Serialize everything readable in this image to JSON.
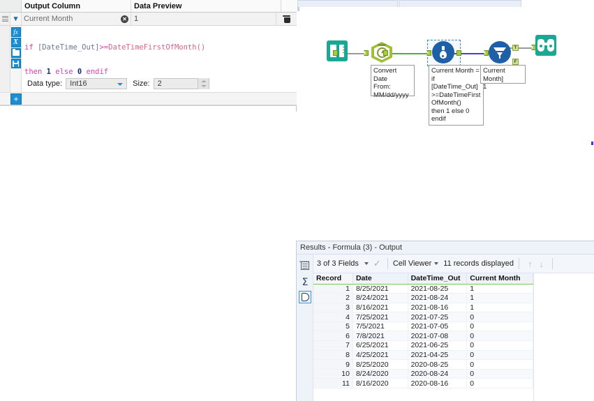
{
  "config_panel": {
    "headers": {
      "output_column": "Output Column",
      "data_preview": "Data Preview"
    },
    "row": {
      "output_column_value": "Current Month",
      "data_preview_value": "1",
      "clear_icon": "clear-circle-icon",
      "delete_icon": "trash-icon",
      "expand_icon": "chevron-down-icon",
      "drag_icon": "drag-handle-icon"
    },
    "rail_buttons": [
      {
        "name": "function-fx-button",
        "glyph": "fx"
      },
      {
        "name": "variable-x-button",
        "glyph": "X"
      },
      {
        "name": "open-folder-button",
        "glyph": "folder-icon"
      },
      {
        "name": "save-button",
        "glyph": "save-disk-icon"
      }
    ],
    "formula": {
      "line1": [
        {
          "t": "if ",
          "c": "kw"
        },
        {
          "t": "[DateTime_Out]",
          "c": "fld"
        },
        {
          "t": ">=",
          "c": "op"
        },
        {
          "t": "DateTimeFirstOfMonth()",
          "c": "fn"
        }
      ],
      "line2": [
        {
          "t": "then ",
          "c": "kw"
        },
        {
          "t": "1",
          "c": "num"
        },
        {
          "t": " else ",
          "c": "kw"
        },
        {
          "t": "0",
          "c": "num"
        },
        {
          "t": " endif",
          "c": "kw"
        }
      ],
      "plain_text": "if [DateTime_Out]>=DateTimeFirstOfMonth()\nthen 1 else 0 endif"
    },
    "data_type_label": "Data type:",
    "data_type_value": "Int16",
    "size_label": "Size:",
    "size_value": "2",
    "add_button_label": "+"
  },
  "canvas": {
    "nodes": [
      {
        "name": "input-data-tool",
        "icon": "book-input-icon",
        "label": ""
      },
      {
        "name": "datetime-tool",
        "icon": "clock-datetime-icon",
        "label": ""
      },
      {
        "name": "formula-tool",
        "icon": "flask-formula-icon",
        "label": "",
        "selected": true
      },
      {
        "name": "filter-tool",
        "icon": "funnel-filter-icon",
        "label": ""
      },
      {
        "name": "browse-tool",
        "icon": "binoculars-browse-icon",
        "label": ""
      }
    ],
    "annotations": {
      "datetime": "Convert Date\nFrom:\nMM/dd/yyyy",
      "formula": "Current Month =\nif [DateTime_Out]\n>=DateTimeFirst\nOfMonth()\nthen 1 else 0 endif",
      "filter": "[Current Month]\n1"
    },
    "filter_ports": {
      "true": "T",
      "false": "F"
    }
  },
  "results": {
    "title": "Results - Formula (3) - Output",
    "toolbar": {
      "fields_selector": "3 of 3 Fields",
      "check_icon": "checkmark-icon",
      "viewer_selector": "Cell Viewer",
      "records_displayed": "11 records displayed",
      "up_icon": "arrow-up-icon",
      "down_icon": "arrow-down-icon"
    },
    "side_buttons": [
      {
        "name": "messages-grid-button",
        "icon": "grid-icon"
      },
      {
        "name": "summary-sigma-button",
        "icon": "sigma-icon"
      },
      {
        "name": "data-view-button",
        "icon": "data-shape-icon",
        "active": true
      }
    ],
    "table": {
      "columns": [
        "Record",
        "Date",
        "DateTime_Out",
        "Current Month"
      ],
      "rows": [
        [
          "1",
          "8/25/2021",
          "2021-08-25",
          "1"
        ],
        [
          "2",
          "8/24/2021",
          "2021-08-24",
          "1"
        ],
        [
          "3",
          "8/16/2021",
          "2021-08-16",
          "1"
        ],
        [
          "4",
          "7/25/2021",
          "2021-07-25",
          "0"
        ],
        [
          "5",
          "7/5/2021",
          "2021-07-05",
          "0"
        ],
        [
          "6",
          "7/8/2021",
          "2021-07-08",
          "0"
        ],
        [
          "7",
          "6/25/2021",
          "2021-06-25",
          "0"
        ],
        [
          "8",
          "4/25/2021",
          "2021-04-25",
          "0"
        ],
        [
          "9",
          "8/25/2020",
          "2020-08-25",
          "0"
        ],
        [
          "10",
          "8/24/2020",
          "2020-08-24",
          "0"
        ],
        [
          "11",
          "8/16/2020",
          "2020-08-16",
          "0"
        ]
      ]
    }
  },
  "colors": {
    "accent_blue": "#1b8fd1",
    "tool_teal": "#19a893",
    "tool_olive": "#9fbf3b",
    "tool_blue": "#1e5fa8",
    "port_green": "#a6ce39",
    "header_green": "#78c850",
    "wire_blue": "#4b3fd1",
    "wire_green": "#4fae3f"
  }
}
